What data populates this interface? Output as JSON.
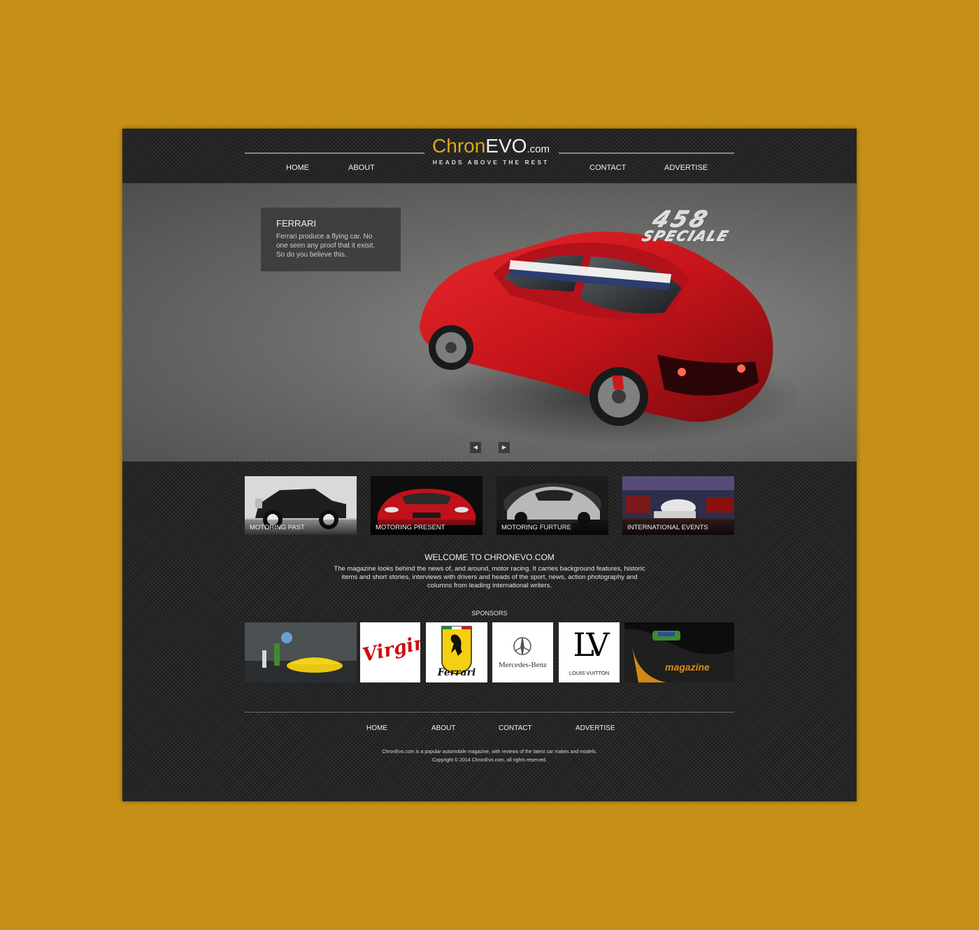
{
  "logo": {
    "chron": "Chron",
    "evo": "EVO",
    "com": ".com",
    "tagline": "HEADS ABOVE THE REST"
  },
  "nav": {
    "home": "HOME",
    "about": "ABOUT",
    "contact": "CONTACT",
    "advertise": "ADVERTISE"
  },
  "hero": {
    "caption_title": "FERRARI",
    "caption_text": "Ferrari produce a flying car. No one seen any proof that it exisit. So do you believe this.",
    "badge_number": "458",
    "badge_word": "SPECIALE",
    "prev_icon": "arrow-left-icon",
    "next_icon": "arrow-right-icon"
  },
  "categories": [
    {
      "label": "MOTORING PAST"
    },
    {
      "label": "MOTORING PRESENT"
    },
    {
      "label": "MOTORING FURTURE"
    },
    {
      "label": "INTERNATIONAL EVENTS"
    }
  ],
  "welcome": {
    "title": "WELCOME TO CHRONEVO.COM",
    "text": "The magazine looks behind the news of, and around, motor racing. It carries background features, historic items and short stories, interviews with drivers and heads of the sport, news, action photography and columns from leading international writers."
  },
  "sponsors": {
    "title": "SPONSORS",
    "virgin": "Virgin",
    "ferrari": "Ferrari",
    "mercedes": "Mercedes-Benz",
    "lv": "LOUIS VUITTON",
    "magazine": "magazine"
  },
  "footer": {
    "home": "HOME",
    "about": "ABOUT",
    "contact": "CONTACT",
    "advertise": "ADVERTISE",
    "description": "ChronEvo.com is a popular automobile magazine, with reviews of the latest car makes and models.",
    "copyright": "Copyright © 2014 ChronEvo.com, all rights reserved."
  },
  "colors": {
    "page_bg": "#c68f17",
    "accent": "#e0a623",
    "site_bg": "#262626"
  }
}
